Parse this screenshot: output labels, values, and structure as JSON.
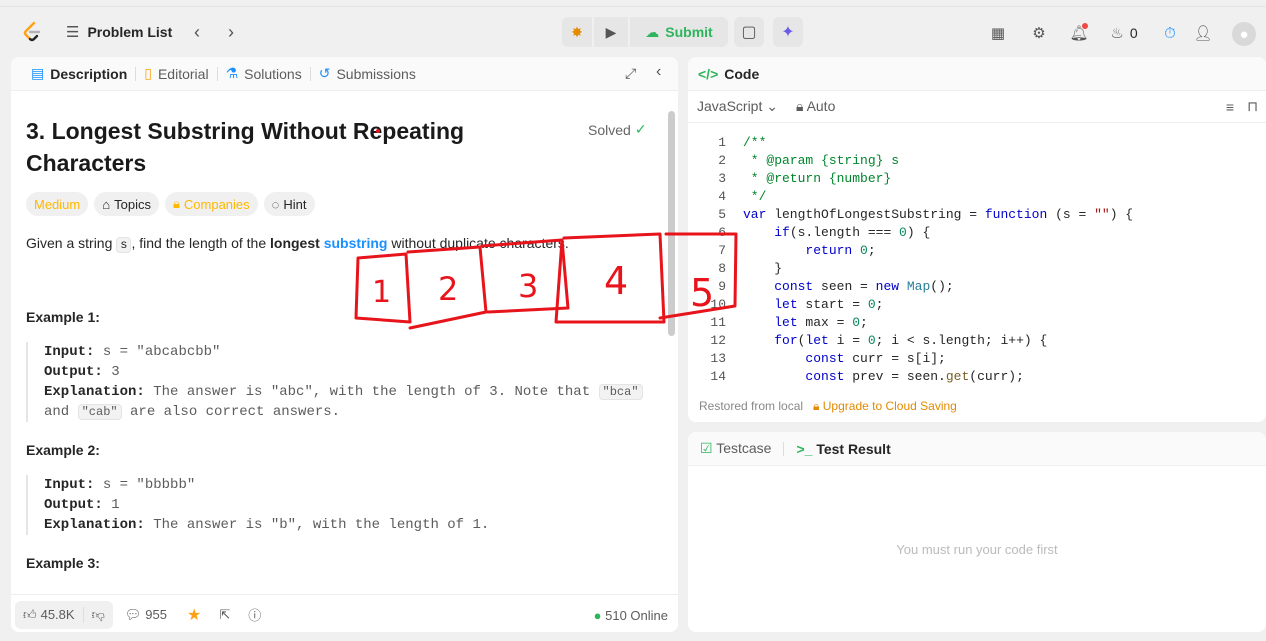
{
  "header": {
    "problem_list": "Problem List",
    "submit": "Submit",
    "fire_count": "0"
  },
  "left": {
    "tabs": [
      "Description",
      "Editorial",
      "Solutions",
      "Submissions"
    ],
    "title": "3. Longest Substring Without Repeating Characters",
    "solved": "Solved",
    "chips": [
      "Medium",
      "Topics",
      "Companies",
      "Hint"
    ],
    "desc": {
      "p1": "Given a string ",
      "code": "s",
      "p2": ", find the length of the ",
      "bold": "longest",
      "link": "substring",
      "p3": " without duplicate characters."
    },
    "examples": [
      {
        "h": "Example 1:",
        "input": "s = \"abcabcbb\"",
        "output": "3",
        "expl_pre": "The answer is \"abc\", with the length of 3. Note that ",
        "c1": "\"bca\"",
        "and": "and ",
        "c2": "\"cab\"",
        "expl_post": " are also correct answers."
      },
      {
        "h": "Example 2:",
        "input": "s = \"bbbbb\"",
        "output": "1",
        "expl": "The answer is \"b\", with the length of 1."
      },
      {
        "h": "Example 3:"
      }
    ],
    "labels": {
      "input": "Input:",
      "output": "Output:",
      "explanation": "Explanation:"
    },
    "footer": {
      "likes": "45.8K",
      "comments": "955",
      "online": "510 Online"
    }
  },
  "code": {
    "header": "Code",
    "language": "JavaScript",
    "auto": "Auto",
    "restored": "Restored from local",
    "upgrade": "Upgrade to Cloud Saving"
  },
  "test": {
    "testcase": "Testcase",
    "result": "Test Result",
    "empty": "You must run your code first"
  },
  "annotations": [
    "1",
    "2",
    "3",
    "4",
    "5"
  ]
}
